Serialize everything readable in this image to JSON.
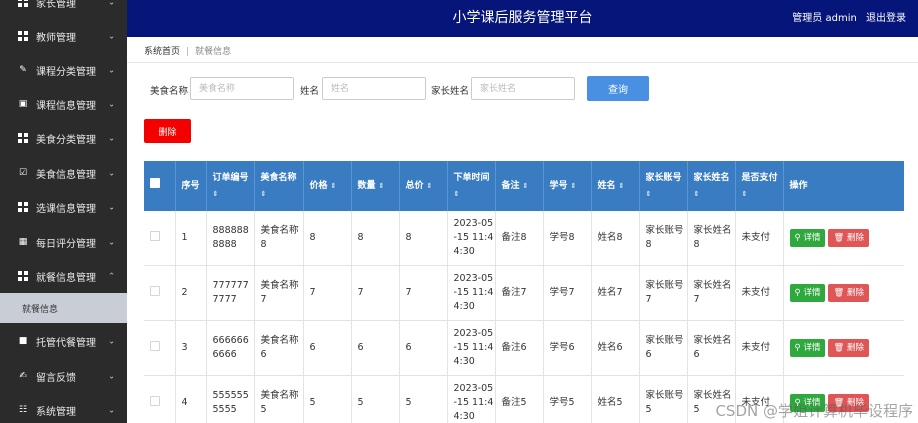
{
  "app": {
    "title": "小学课后服务管理平台",
    "user": "管理员 admin",
    "logout": "退出登录"
  },
  "sidebar": {
    "items": [
      {
        "label": "家长管理",
        "icon": "grid-icon"
      },
      {
        "label": "教师管理",
        "icon": "grid-icon"
      },
      {
        "label": "课程分类管理",
        "icon": "pencil-icon"
      },
      {
        "label": "课程信息管理",
        "icon": "monitor-icon"
      },
      {
        "label": "美食分类管理",
        "icon": "grid-icon"
      },
      {
        "label": "美食信息管理",
        "icon": "checklist-icon"
      },
      {
        "label": "选课信息管理",
        "icon": "grid-icon"
      },
      {
        "label": "每日评分管理",
        "icon": "calendar-icon"
      },
      {
        "label": "就餐信息管理",
        "icon": "grid-icon"
      },
      {
        "label": "托管代餐管理",
        "icon": "comment-icon"
      },
      {
        "label": "留言反馈",
        "icon": "edit-icon"
      },
      {
        "label": "系统管理",
        "icon": "apps-icon"
      }
    ],
    "sub_item": "就餐信息"
  },
  "breadcrumb": {
    "home": "系统首页",
    "current": "就餐信息"
  },
  "search": {
    "food_label": "美食名称",
    "food_placeholder": "美食名称",
    "name_label": "姓名",
    "name_placeholder": "姓名",
    "parent_label": "家长姓名",
    "parent_placeholder": "家长姓名",
    "query_button": "查询"
  },
  "delete_button": "删除",
  "table": {
    "headers": [
      "序号",
      "订单编号",
      "美食名称",
      "价格",
      "数量",
      "总价",
      "下单时间",
      "备注",
      "学号",
      "姓名",
      "家长账号",
      "家长姓名",
      "是否支付",
      "操作"
    ],
    "sort_icon": "⇕",
    "detail_label": "详情",
    "remove_label": "删除",
    "rows": [
      {
        "no": "1",
        "order": "8888888888",
        "food": "美食名称8",
        "price": "8",
        "qty": "8",
        "total": "8",
        "time": "2023-05-15 11:44:30",
        "note": "备注8",
        "sid": "学号8",
        "name": "姓名8",
        "pacc": "家长账号8",
        "pname": "家长姓名8",
        "paid": "未支付"
      },
      {
        "no": "2",
        "order": "7777777777",
        "food": "美食名称7",
        "price": "7",
        "qty": "7",
        "total": "7",
        "time": "2023-05-15 11:44:30",
        "note": "备注7",
        "sid": "学号7",
        "name": "姓名7",
        "pacc": "家长账号7",
        "pname": "家长姓名7",
        "paid": "未支付"
      },
      {
        "no": "3",
        "order": "6666666666",
        "food": "美食名称6",
        "price": "6",
        "qty": "6",
        "total": "6",
        "time": "2023-05-15 11:44:30",
        "note": "备注6",
        "sid": "学号6",
        "name": "姓名6",
        "pacc": "家长账号6",
        "pname": "家长姓名6",
        "paid": "未支付"
      },
      {
        "no": "4",
        "order": "5555555555",
        "food": "美食名称5",
        "price": "5",
        "qty": "5",
        "total": "5",
        "time": "2023-05-15 11:44:30",
        "note": "备注5",
        "sid": "学号5",
        "name": "姓名5",
        "pacc": "家长账号5",
        "pname": "家长姓名5",
        "paid": "未支付"
      }
    ]
  },
  "watermark": "CSDN @学姐计算机毕设程序",
  "colors": {
    "header": "#06157a",
    "sidebar": "#2b2b2b",
    "table_head": "#3a7cc2",
    "danger": "#f40000",
    "query": "#4a90e2",
    "detail": "#2fa93e"
  }
}
